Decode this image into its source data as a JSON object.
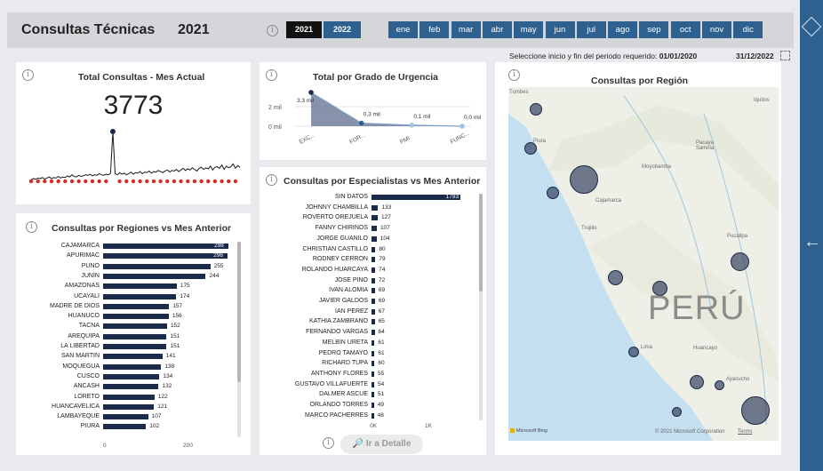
{
  "header": {
    "title": "Consultas Técnicas",
    "year": "2021",
    "year_buttons": [
      {
        "label": "2021",
        "active": true
      },
      {
        "label": "2022",
        "active": false
      }
    ],
    "months": [
      "ene",
      "feb",
      "mar",
      "abr",
      "may",
      "jun",
      "jul",
      "ago",
      "sep",
      "oct",
      "nov",
      "dic"
    ],
    "colors": {
      "bar": "#d4d6da",
      "month_button": "#2e6190",
      "active_year": "#111111",
      "inactive_year": "#2e6190"
    }
  },
  "range": {
    "label": "Seleccione inicio y fin del periodo requerido:",
    "start": "01/01/2020",
    "end": "31/12/2022"
  },
  "card_total": {
    "title": "Total Consultas - Mes Actual",
    "value": "3773"
  },
  "urgency_chart": {
    "title": "Total por Grado de Urgencia",
    "y_ticks": [
      "2 mil",
      "0 mil"
    ],
    "categories": [
      "EXC...",
      "FOR...",
      "PMI",
      "FUNC..."
    ],
    "value_labels": [
      "3,3 mil",
      "0,3 mil",
      "0,1 mil",
      "0,0 mil"
    ]
  },
  "regions_chart": {
    "title": "Consultas por Regiones vs Mes Anterior",
    "axis_ticks": [
      "0",
      "200"
    ]
  },
  "specialists_chart": {
    "title": "Consultas por Especialistas vs Mes Anterior",
    "axis_ticks": [
      "0K",
      "1K"
    ]
  },
  "detail_button": {
    "label": "Ir a Detalle"
  },
  "map": {
    "title": "Consultas por Región",
    "country_label": "PERÚ",
    "place_labels": {
      "tumbes": "Tumbes",
      "piura": "Piura",
      "cajamarca": "Cajamarca",
      "trujillo": "Trujillo",
      "moyobamba": "Moyobamba",
      "pucallpa": "Pucallpa",
      "lima": "Lima",
      "huancayo": "Huancayo",
      "ayacucho": "Ayacucho",
      "pacaya": "Pacaya Samiria",
      "iquitos": "Iquitos"
    },
    "provider": "Microsoft Bing",
    "copyright": "© 2021 Microsoft Corporation",
    "terms": "Terms"
  },
  "chart_data": [
    {
      "type": "line",
      "title": "Total Consultas - Mes Actual",
      "note": "daily consultas sparkline; values not labeled",
      "series": [
        {
          "values": [
            3,
            5,
            4,
            6,
            5,
            7,
            4,
            6,
            8,
            5,
            7,
            6,
            9,
            6,
            8,
            7,
            10,
            8,
            12,
            9,
            8,
            11,
            9,
            10,
            12,
            11,
            13,
            10,
            12,
            11,
            14,
            12,
            11,
            13,
            12,
            15,
            92,
            14,
            12,
            16,
            13,
            15,
            12,
            14,
            17,
            13,
            16,
            15,
            18,
            14,
            17,
            16,
            19,
            15,
            18,
            17,
            20,
            18,
            16,
            19,
            21,
            17,
            20,
            19,
            22,
            18,
            21,
            24,
            20,
            23,
            21,
            25,
            22,
            19,
            24,
            26,
            22,
            25,
            23,
            28,
            21,
            26,
            27,
            24,
            30,
            22,
            28,
            25,
            27,
            32,
            24,
            29,
            26
          ]
        }
      ]
    },
    {
      "type": "area",
      "title": "Total por Grado de Urgencia",
      "categories": [
        "EXC...",
        "FOR...",
        "PMI",
        "FUNC..."
      ],
      "values": [
        3300,
        300,
        100,
        0
      ],
      "ylim": [
        0,
        3300
      ]
    },
    {
      "type": "bar",
      "title": "Consultas por Regiones vs Mes Anterior",
      "categories": [
        "CAJAMARCA",
        "APURIMAC",
        "PUNO",
        "JUNIN",
        "AMAZONAS",
        "UCAYALI",
        "MADRE DE DIOS",
        "HUANUCO",
        "TACNA",
        "AREQUIPA",
        "LA LIBERTAD",
        "SAN MARTIN",
        "MOQUEGUA",
        "CUSCO",
        "ANCASH",
        "LORETO",
        "HUANCAVELICA",
        "LAMBAYEQUE",
        "PIURA"
      ],
      "values": [
        298,
        296,
        255,
        244,
        175,
        174,
        157,
        156,
        152,
        151,
        151,
        141,
        138,
        134,
        132,
        122,
        121,
        107,
        102
      ],
      "xlim": [
        0,
        300
      ]
    },
    {
      "type": "bar",
      "title": "Consultas por Especialistas vs Mes Anterior",
      "categories": [
        "SIN DATOS",
        "JOHNNY CHAMBILLA",
        "ROVERTO OREJUELA",
        "FANNY CHIRINOS",
        "JORGE GUANILO",
        "CHRISTIAN CASTILLO",
        "RODNEY CERRON",
        "ROLANDO HUARCAYA",
        "JOSE PINO",
        "IVAN ALOMIA",
        "JAVIER GALDOS",
        "IAN PEREZ",
        "KATHIA ZAMBRANO",
        "FERNANDO VARGAS",
        "MELBIN URETA",
        "PEDRO TAMAYO",
        "RICHARD TUPA",
        "ANTHONY FLORES",
        "GUSTAVO VILLAFUERTE",
        "DALMER ASCUE",
        "ORLANDO TORRES",
        "MARCO PACHERRES"
      ],
      "values": [
        1793,
        133,
        127,
        107,
        104,
        80,
        79,
        74,
        72,
        69,
        69,
        67,
        65,
        64,
        61,
        61,
        60,
        55,
        54,
        51,
        49,
        48
      ],
      "xlim": [
        0,
        1800
      ]
    }
  ]
}
